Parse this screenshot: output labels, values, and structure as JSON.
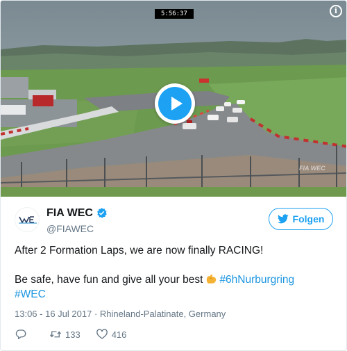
{
  "media": {
    "timestamp": "5:56:37",
    "watermark": "FIA WEC"
  },
  "author": {
    "display_name": "FIA WEC",
    "handle": "@FIAWEC",
    "verified": true
  },
  "follow_button": {
    "label": "Folgen"
  },
  "tweet": {
    "line1": "After 2 Formation Laps, we are now finally RACING!",
    "line2_text": "Be safe, have fun and give all your best",
    "hashtag1": "#6hNurburgring",
    "hashtag2": "#WEC"
  },
  "meta": {
    "time": "13:06",
    "separator": " - ",
    "date": "16 Jul 2017",
    "dot": " · ",
    "location": "Rhineland-Palatinate, Germany"
  },
  "actions": {
    "retweets": "133",
    "likes": "416"
  },
  "colors": {
    "accent": "#1da1f2",
    "hashtag": "#1b95e0",
    "secondary_text": "#657786"
  }
}
